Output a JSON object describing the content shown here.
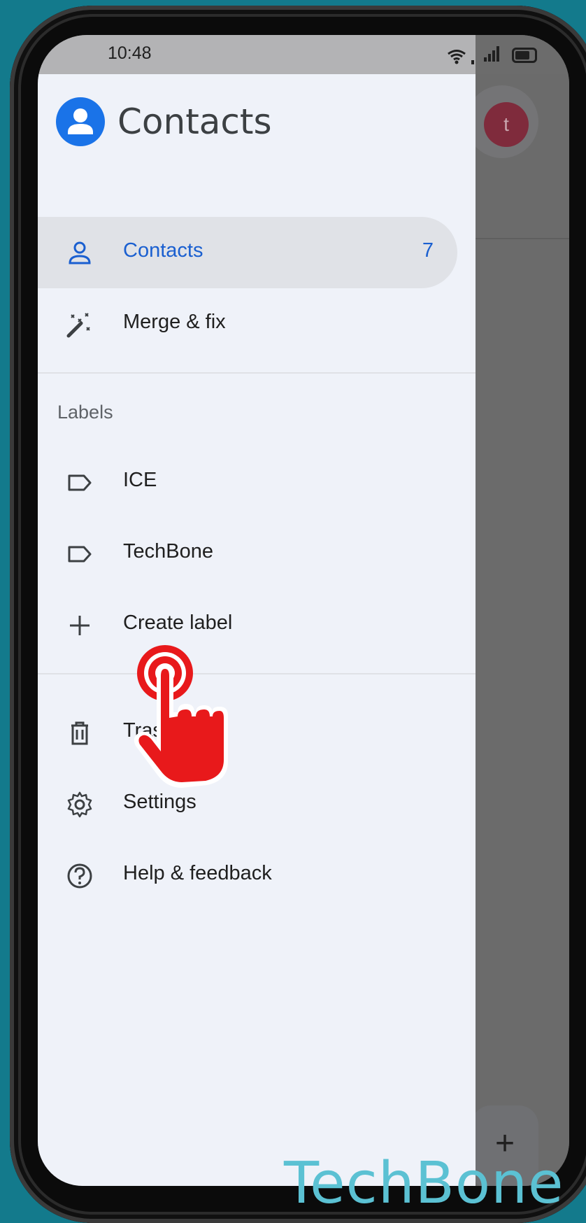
{
  "status_bar": {
    "time": "10:48"
  },
  "background": {
    "avatar_letter": "t",
    "fab_symbol": "+"
  },
  "drawer": {
    "app_title": "Contacts",
    "primary": [
      {
        "label": "Contacts",
        "count": "7",
        "icon": "person-icon"
      },
      {
        "label": "Merge & fix",
        "icon": "magic-wand-icon"
      }
    ],
    "labels_heading": "Labels",
    "labels": [
      {
        "label": "ICE",
        "icon": "label-icon"
      },
      {
        "label": "TechBone",
        "icon": "label-icon"
      },
      {
        "label": "Create label",
        "icon": "plus-icon"
      }
    ],
    "footer": [
      {
        "label": "Trash",
        "icon": "trash-icon"
      },
      {
        "label": "Settings",
        "icon": "gear-icon"
      },
      {
        "label": "Help & feedback",
        "icon": "help-icon"
      }
    ]
  },
  "watermark": "TechBone",
  "colors": {
    "accent": "#1a73e8",
    "drawer_bg": "#eff2f9",
    "active_text": "#1a5fd0",
    "tap_red": "#e8191b",
    "page_bg": "#137a8c"
  }
}
